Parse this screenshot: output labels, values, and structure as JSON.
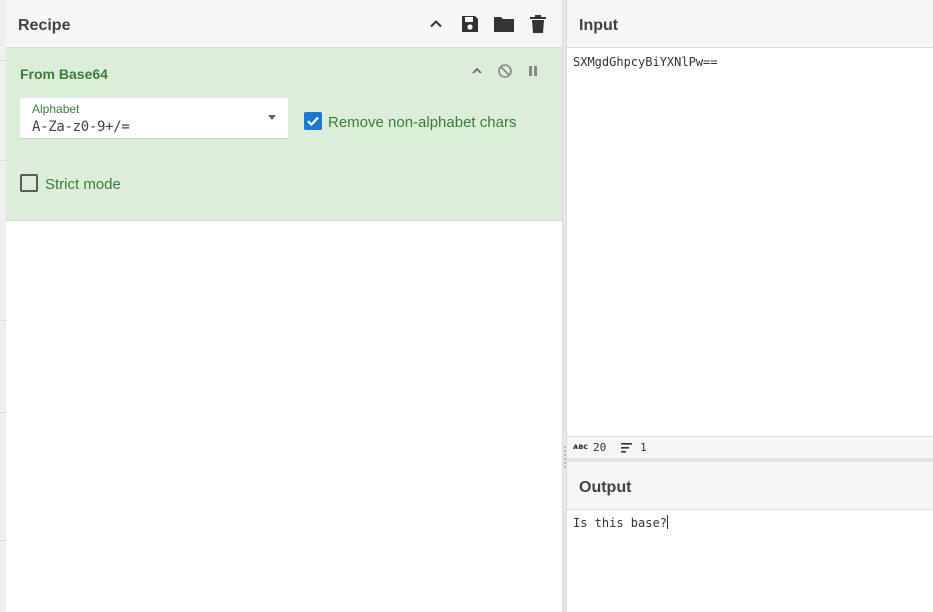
{
  "recipe": {
    "title": "Recipe",
    "header_icons": [
      "chevron-up-icon",
      "save-icon",
      "folder-icon",
      "trash-icon"
    ],
    "operation": {
      "title": "From Base64",
      "controls": [
        "chevron-up-icon",
        "disable-icon",
        "pause-icon"
      ],
      "alphabet_label": "Alphabet",
      "alphabet_value": "A-Za-z0-9+/=",
      "remove_non_alphabet_label": "Remove non-alphabet chars",
      "remove_non_alphabet_checked": true,
      "strict_mode_label": "Strict mode",
      "strict_mode_checked": false
    }
  },
  "input": {
    "title": "Input",
    "text": "SXMgdGhpcyBiYXNlPw==",
    "status": {
      "chars": "20",
      "lines": "1"
    }
  },
  "output": {
    "title": "Output",
    "text": "Is this base?"
  },
  "colors": {
    "operation_bg": "#dcedd9",
    "operation_text": "#3a7d3a",
    "checkbox_blue": "#1e77d2"
  }
}
